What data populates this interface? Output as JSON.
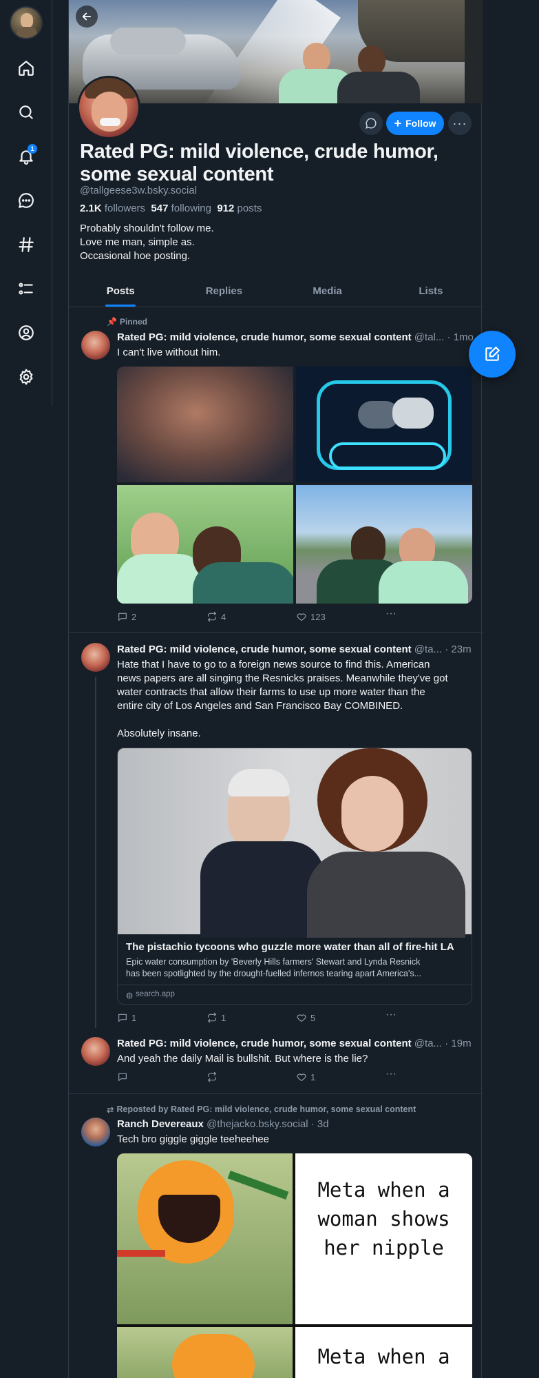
{
  "sidebar": {
    "notification_count": "1",
    "items": [
      "home-icon",
      "search-icon",
      "bell-icon",
      "chat-icon",
      "hash-icon",
      "list-icon",
      "profile-icon",
      "gear-icon"
    ]
  },
  "profile": {
    "display_name": "Rated PG: mild violence, crude humor, some sexual content",
    "handle": "@tallgeese3w.bsky.social",
    "followers_count": "2.1K",
    "followers_label": "followers",
    "following_count": "547",
    "following_label": "following",
    "posts_count": "912",
    "posts_label": "posts",
    "bio_lines": [
      "Probably shouldn't follow me.",
      "Love me man, simple as.",
      "Occasional hoe posting."
    ],
    "follow_label": "Follow"
  },
  "tabs": [
    "Posts",
    "Replies",
    "Media",
    "Lists"
  ],
  "posts": [
    {
      "pinned_label": "Pinned",
      "author": "Rated PG: mild violence, crude humor, some sexual content",
      "handle": "@tal...",
      "time": "· 1mo",
      "text": "I can't live without him.",
      "replies": "2",
      "reposts": "4",
      "likes": "123"
    },
    {
      "author": "Rated PG: mild violence, crude humor, some sexual content",
      "handle": "@ta...",
      "time": "· 23m",
      "text_lines": [
        "Hate that I have to go to a foreign news source to find this. American",
        "news papers are all singing the Resnicks praises. Meanwhile they've got",
        "water contracts that allow their farms to use up more water than the",
        "entire city of Los Angeles and San Francisco Bay COMBINED."
      ],
      "text_2": "Absolutely insane.",
      "link_card": {
        "title": "The pistachio tycoons who guzzle more water than all of fire-hit LA",
        "desc_line1": "Epic water consumption by 'Beverly Hills farmers' Stewart and Lynda Resnick",
        "desc_line2": "has been spotlighted by the drought-fuelled infernos tearing apart America's...",
        "domain": "search.app"
      },
      "replies": "1",
      "reposts": "1",
      "likes": "5"
    },
    {
      "author": "Rated PG: mild violence, crude humor, some sexual content",
      "handle": "@ta...",
      "time": "· 19m",
      "text": "And yeah the daily Mail is bullshit. But where is the lie?",
      "replies": "",
      "reposts": "",
      "likes": "1"
    },
    {
      "repost_label": "Reposted by Rated PG: mild violence, crude humor, some sexual content",
      "author": "Ranch Devereaux",
      "handle": "@thejacko.bsky.social",
      "time": "· 3d",
      "text": "Tech bro giggle giggle teeheehee",
      "meme_text_1": [
        "Meta when a",
        "woman shows",
        "her nipple"
      ],
      "meme_text_2": "Meta when a"
    }
  ],
  "colors": {
    "background": "#161e27",
    "accent": "#1083fe",
    "muted": "#8d9bab",
    "border": "#2e3a47"
  }
}
